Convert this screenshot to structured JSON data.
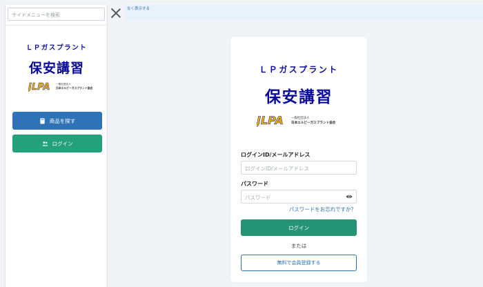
{
  "sidebar": {
    "search_placeholder": "サイドメニューを検索",
    "brand_en": "ＬＰガスプラント",
    "brand_jp": "保安講習",
    "logo_mark": "JLPA",
    "logo_org_line1": "一般社団法人",
    "logo_org_line2": "日本エルピーガスプラント協会",
    "shop_button": "商品を探す",
    "login_button": "ログイン",
    "shop_icon": "book-icon",
    "login_icon": "users-icon"
  },
  "notice": {
    "text": "なく表示する"
  },
  "card": {
    "brand_en": "ＬＰガスプラント",
    "brand_jp": "保安講習",
    "logo_mark": "JLPA",
    "logo_org_line1": "一般社団法人",
    "logo_org_line2": "日本エルピーガスプラント協会",
    "id_label": "ログインID/メールアドレス",
    "id_placeholder": "ログインID/メールアドレス",
    "password_label": "パスワード",
    "password_placeholder": "パスワード",
    "forgot_link": "パスワードをお忘れですか？",
    "login_button": "ログイン",
    "or_text": "または",
    "register_button": "無料で会員登録する"
  },
  "colors": {
    "brand_navy": "#0a0a9a",
    "shop_blue": "#2e73b8",
    "login_green": "#24a07a",
    "link_blue": "#2c6fb3"
  }
}
